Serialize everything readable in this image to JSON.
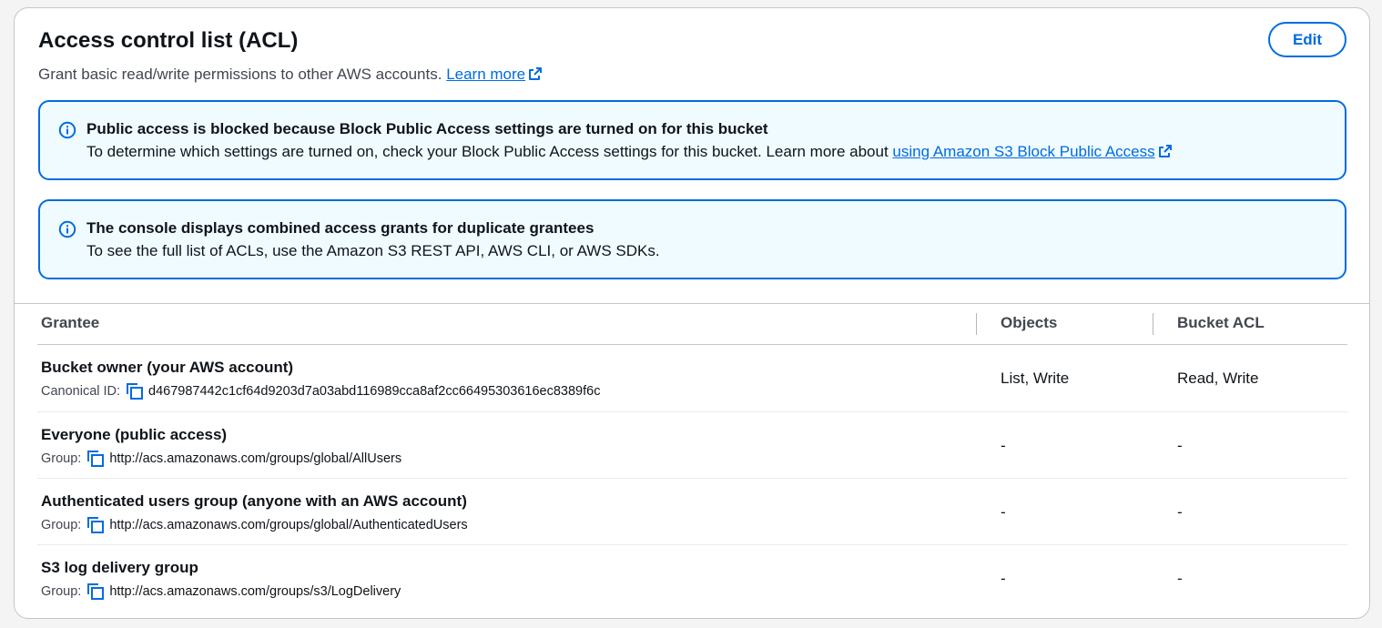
{
  "panel": {
    "title": "Access control list (ACL)",
    "description": "Grant basic read/write permissions to other AWS accounts.",
    "learn_more": "Learn more",
    "edit_label": "Edit"
  },
  "alerts": [
    {
      "heading": "Public access is blocked because Block Public Access settings are turned on for this bucket",
      "body": "To determine which settings are turned on, check your Block Public Access settings for this bucket. Learn more about ",
      "link": "using Amazon S3 Block Public Access"
    },
    {
      "heading": "The console displays combined access grants for duplicate grantees",
      "body": "To see the full list of ACLs, use the Amazon S3 REST API, AWS CLI, or AWS SDKs."
    }
  ],
  "table": {
    "columns": [
      "Grantee",
      "Objects",
      "Bucket ACL"
    ],
    "rows": [
      {
        "name": "Bucket owner (your AWS account)",
        "id_label": "Canonical ID:",
        "id_value": "d467987442c1cf64d9203d7a03abd116989cca8af2cc66495303616ec8389f6c",
        "objects": "List, Write",
        "bucket_acl": "Read, Write"
      },
      {
        "name": "Everyone (public access)",
        "id_label": "Group:",
        "id_value": "http://acs.amazonaws.com/groups/global/AllUsers",
        "objects": "-",
        "bucket_acl": "-"
      },
      {
        "name": "Authenticated users group (anyone with an AWS account)",
        "id_label": "Group:",
        "id_value": "http://acs.amazonaws.com/groups/global/AuthenticatedUsers",
        "objects": "-",
        "bucket_acl": "-"
      },
      {
        "name": "S3 log delivery group",
        "id_label": "Group:",
        "id_value": "http://acs.amazonaws.com/groups/s3/LogDelivery",
        "objects": "-",
        "bucket_acl": "-"
      }
    ]
  },
  "colors": {
    "accent": "#006ce0",
    "alert_background": "#f0fbff",
    "border": "#c6c6cd"
  },
  "icons": [
    "info-icon",
    "external-link-icon",
    "copy-icon"
  ]
}
